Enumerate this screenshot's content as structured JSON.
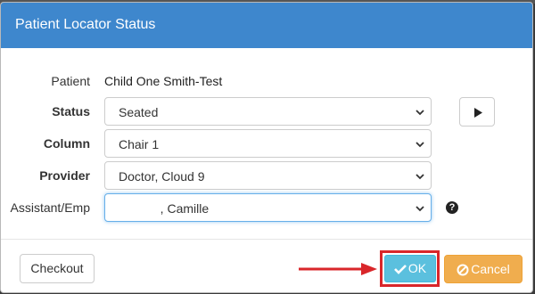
{
  "dialog": {
    "title": "Patient Locator Status"
  },
  "fields": {
    "patient": {
      "label": "Patient",
      "value": "Child One Smith-Test"
    },
    "status": {
      "label": "Status",
      "value": "Seated"
    },
    "column": {
      "label": "Column",
      "value": "Chair 1"
    },
    "provider": {
      "label": "Provider",
      "value": "Doctor, Cloud 9"
    },
    "assistant": {
      "label": "Assistant/Emp",
      "value": "            , Camille"
    }
  },
  "buttons": {
    "checkout": "Checkout",
    "ok": "OK",
    "cancel": "Cancel"
  },
  "icons": {
    "play": "play-icon",
    "help": "question-circle-icon",
    "check": "check-icon",
    "ban": "ban-icon"
  },
  "colors": {
    "header": "#3e87cd",
    "ok": "#5bc0de",
    "cancel": "#f0ad4e",
    "highlight": "#d9262a"
  }
}
